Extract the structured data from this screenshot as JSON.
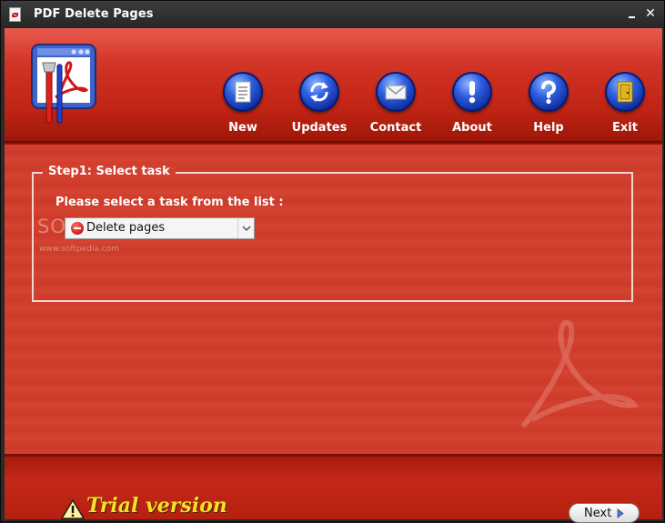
{
  "window": {
    "title": "PDF Delete Pages"
  },
  "toolbar": {
    "items": [
      {
        "label": "New",
        "icon": "document-icon"
      },
      {
        "label": "Updates",
        "icon": "refresh-icon"
      },
      {
        "label": "Contact",
        "icon": "envelope-icon"
      },
      {
        "label": "About",
        "icon": "exclamation-icon"
      },
      {
        "label": "Help",
        "icon": "question-icon"
      },
      {
        "label": "Exit",
        "icon": "door-icon"
      }
    ]
  },
  "step": {
    "legend": "Step1: Select task",
    "prompt": "Please select a task from the list :",
    "selected_task": "Delete pages"
  },
  "watermark": {
    "brand": "SOFTPEDIA",
    "url": "www.softpedia.com"
  },
  "footer": {
    "trial_label": "Trial version",
    "next_label": "Next"
  },
  "colors": {
    "accent_red": "#c42618",
    "orb_blue": "#2f5fe0",
    "trial_yellow": "#f3e22a"
  }
}
